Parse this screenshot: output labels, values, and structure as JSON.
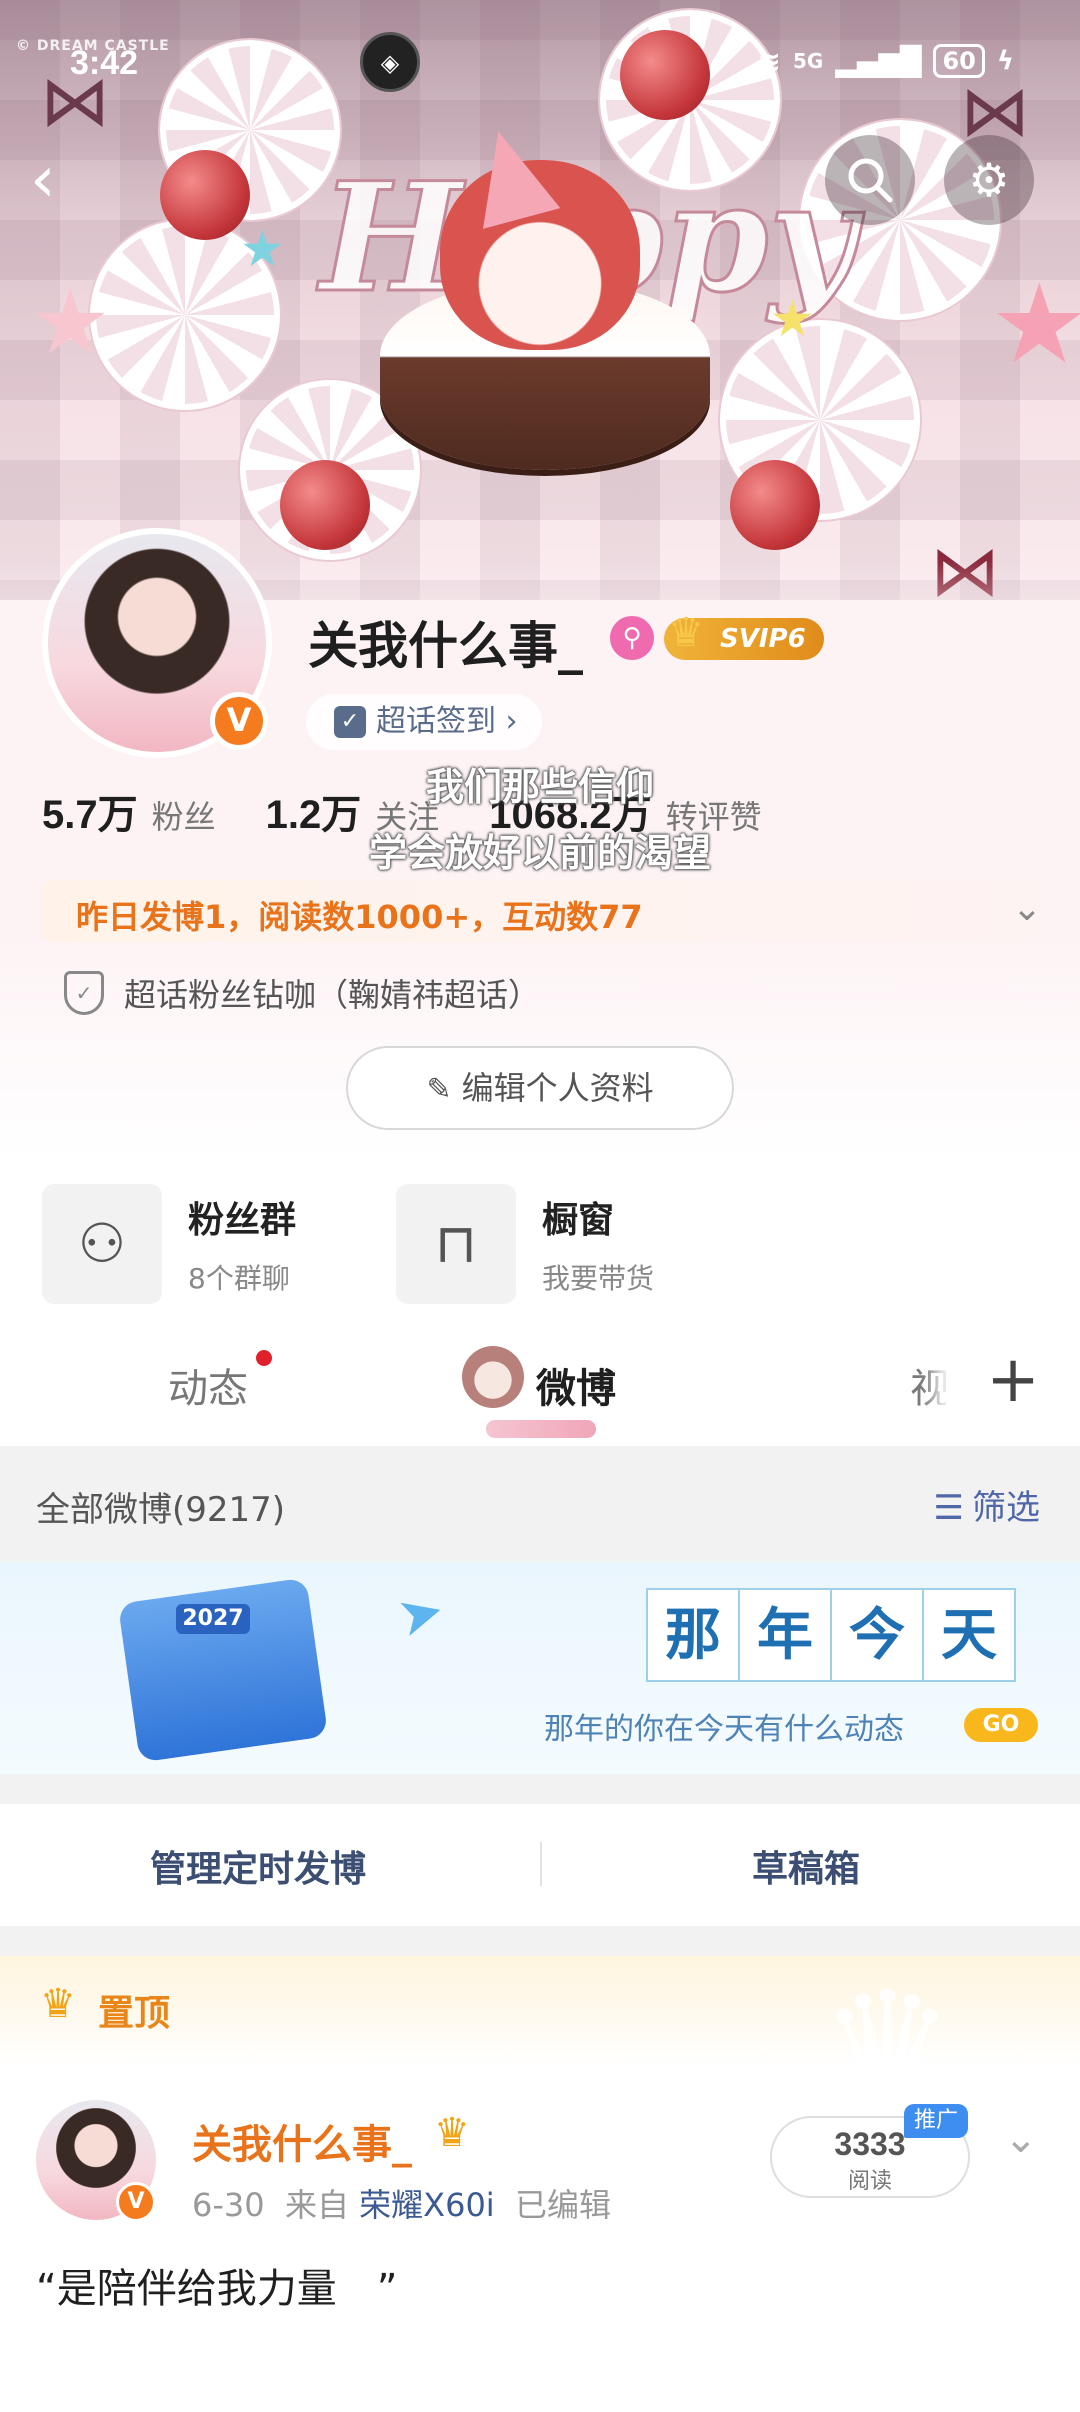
{
  "status_bar": {
    "brand": "© DREAM CASTLE",
    "time": "3:42",
    "signal": "5G",
    "battery": "60"
  },
  "nav": {
    "back_icon": "back-arrow-icon",
    "search_icon": "search-icon",
    "settings_icon": "gear-icon"
  },
  "banner": {
    "art_text": "Happy"
  },
  "profile": {
    "username": "关我什么事_",
    "svip": "SVIP6",
    "checkin_label": "超话签到 ›",
    "stats": [
      {
        "value": "5.7万",
        "label": "粉丝"
      },
      {
        "value": "1.2万",
        "label": "关注"
      },
      {
        "value": "1068.2万",
        "label": "转评赞"
      }
    ],
    "activity": "昨日发博1，阅读数1000+，互动数77",
    "fan_badge": "超话粉丝钻咖（鞠婧祎超话）",
    "edit_button": "编辑个人资料"
  },
  "lyrics": {
    "line1": "我们那些信仰",
    "line2": "学会放好以前的渴望"
  },
  "tiles": [
    {
      "title": "粉丝群",
      "subtitle": "8个群聊",
      "icon": "people-icon"
    },
    {
      "title": "橱窗",
      "subtitle": "我要带货",
      "icon": "shopping-bag-icon"
    }
  ],
  "tabs": [
    {
      "label": "动态"
    },
    {
      "label": "微博"
    },
    {
      "label": "视"
    }
  ],
  "list_header": {
    "all_label": "全部微博(9217)",
    "filter_label": "筛选"
  },
  "on_this_day": {
    "year": "2027",
    "chars": [
      "那",
      "年",
      "今",
      "天"
    ],
    "subtitle": "那年的你在今天有什么动态",
    "go": "GO"
  },
  "actions": {
    "scheduled": "管理定时发博",
    "drafts": "草稿箱"
  },
  "pinned": {
    "label": "置顶",
    "author": "关我什么事_",
    "date": "6-30",
    "from_label": "来自",
    "device": "荣耀X60i",
    "edited": "已编辑",
    "reads": "3333",
    "reads_label": "阅读",
    "promo": "推广",
    "text": "“是陪伴给我力量　”"
  },
  "colors": {
    "accent_orange": "#e8731a",
    "vip_gold": "#f0b43a",
    "link_blue": "#4f66a8"
  }
}
